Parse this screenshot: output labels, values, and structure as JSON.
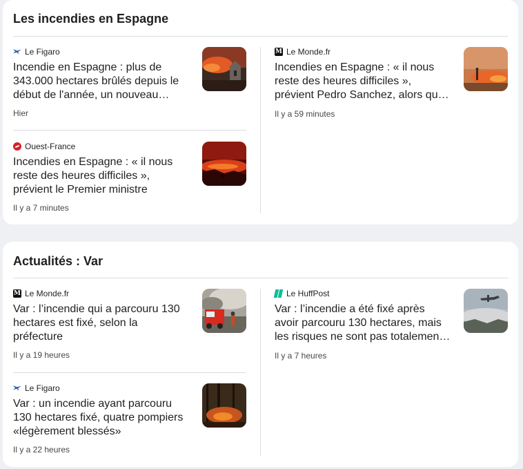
{
  "sections": [
    {
      "title": "Les incendies en Espagne",
      "stories": [
        {
          "source": "Le Figaro",
          "source_icon": "figaro-logo-icon",
          "headline": "Incendie en Espagne : plus de 343.000 hectares brûlés depuis le début de l'année, un nouveau record",
          "time": "Hier"
        },
        {
          "source": "Ouest-France",
          "source_icon": "ouest-france-logo-icon",
          "headline": "Incendies en Espagne : « il nous reste des heures difficiles », prévient le Premier ministre",
          "time": "Il y a 7 minutes"
        },
        {
          "source": "Le Monde.fr",
          "source_icon": "le-monde-logo-icon",
          "headline": "Incendies en Espagne : « il nous reste des heures difficiles », prévient Pedro Sanchez, alors que les flammes progressent",
          "time": "Il y a 59 minutes"
        }
      ]
    },
    {
      "title": "Actualités : Var",
      "stories": [
        {
          "source": "Le Monde.fr",
          "source_icon": "le-monde-logo-icon",
          "headline": "Var : l’incendie qui a parcouru 130 hectares est fixé, selon la préfecture",
          "time": "Il y a 19 heures"
        },
        {
          "source": "Le Figaro",
          "source_icon": "figaro-logo-icon",
          "headline": "Var : un incendie ayant parcouru 130 hectares fixé, quatre pompiers «légèrement blessés»",
          "time": "Il y a 22 heures"
        },
        {
          "source": "Le HuffPost",
          "source_icon": "huffpost-logo-icon",
          "headline": "Var : l’incendie a été fixé après avoir parcouru 130 hectares, mais les risques ne sont pas totalement écartés",
          "time": "Il y a 7 heures"
        }
      ]
    }
  ]
}
